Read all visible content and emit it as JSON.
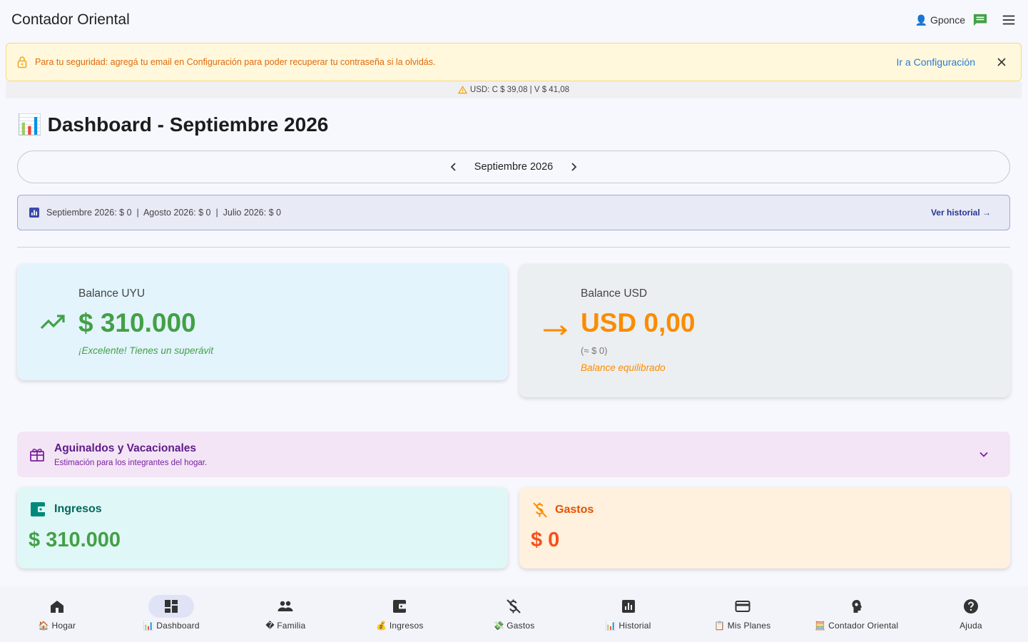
{
  "appbar": {
    "title": "Contador Oriental",
    "user": "👤 Gponce"
  },
  "alert": {
    "message": "Para tu seguridad: agregá tu email en Configuración para poder recuperar tu contraseña si la olvidás.",
    "link": "Ir a Configuración"
  },
  "fx": {
    "text": "USD: C $ 39,08 | V $ 41,08"
  },
  "page": {
    "title": "📊 Dashboard - Septiembre 2026"
  },
  "month_nav": {
    "current": "Septiembre 2026"
  },
  "summary": {
    "text": "Septiembre 2026: $ 0  |  Agosto 2026: $ 0  |  Julio 2026: $ 0",
    "link": "Ver historial →"
  },
  "balance_uyu": {
    "label": "Balance UYU",
    "value": "$ 310.000",
    "note": "¡Excelente! Tienes un superávit",
    "color": "#43a047"
  },
  "balance_usd": {
    "label": "Balance USD",
    "value": "USD 0,00",
    "sub": "(≈ $ 0)",
    "note": "Balance equilibrado",
    "color": "#fb8c00"
  },
  "aguinaldos": {
    "title": "Aguinaldos y Vacacionales",
    "subtitle": "Estimación para los integrantes del hogar."
  },
  "ingresos": {
    "label": "Ingresos",
    "value": "$ 310.000"
  },
  "gastos": {
    "label": "Gastos",
    "value": "$ 0"
  },
  "bottom_nav": {
    "items": [
      {
        "label": "🏠 Hogar",
        "icon": "home-icon"
      },
      {
        "label": "📊 Dashboard",
        "icon": "dashboard-icon",
        "active": true
      },
      {
        "label": "� Familia",
        "icon": "people-icon"
      },
      {
        "label": "💰 Ingresos",
        "icon": "wallet-icon"
      },
      {
        "label": "💸 Gastos",
        "icon": "money-off-icon"
      },
      {
        "label": "📊 Historial",
        "icon": "bar-chart-icon"
      },
      {
        "label": "📋 Mis Planes",
        "icon": "credit-card-icon"
      },
      {
        "label": "🧮 Contador Oriental",
        "icon": "psychology-icon"
      },
      {
        "label": "Ajuda",
        "icon": "help-icon"
      }
    ]
  }
}
